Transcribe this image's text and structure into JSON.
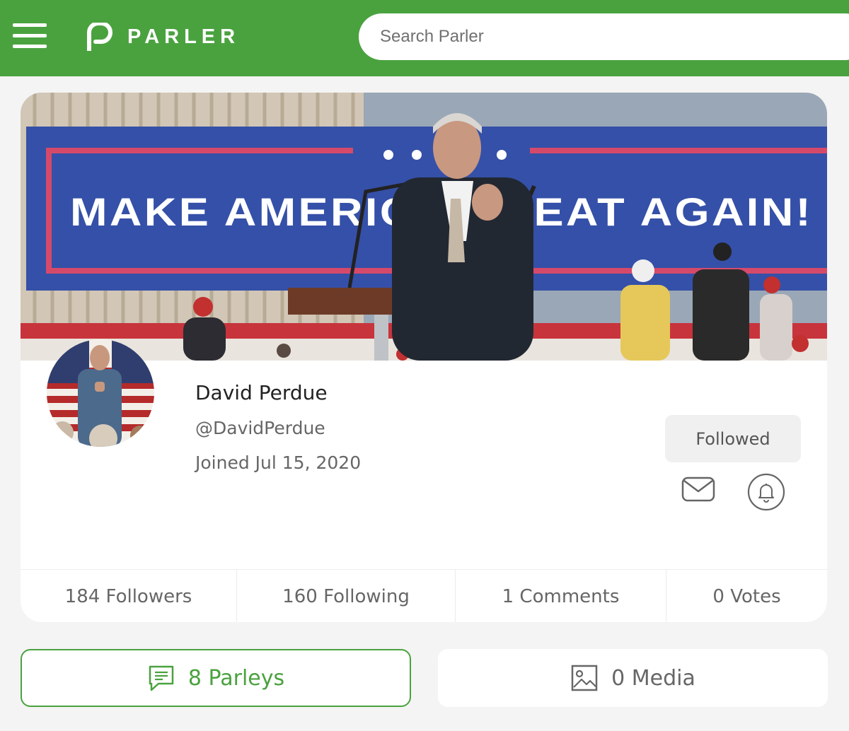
{
  "header": {
    "brand_name": "PARLER",
    "search_placeholder": "Search Parler",
    "accent_color": "#4aa23f"
  },
  "cover": {
    "banner_text": "MAKE AMERICA GREAT AGAIN!"
  },
  "profile": {
    "display_name": "David Perdue",
    "handle": "@DavidPerdue",
    "joined": "Joined Jul 15, 2020",
    "follow_button_label": "Followed",
    "icons": [
      "envelope-icon",
      "bell-icon"
    ]
  },
  "stats": [
    {
      "label": "184 Followers"
    },
    {
      "label": "160 Following"
    },
    {
      "label": "1 Comments"
    },
    {
      "label": "0 Votes"
    }
  ],
  "tabs": {
    "parleys_label": "8 Parleys",
    "media_label": "0 Media",
    "active": "parleys"
  }
}
